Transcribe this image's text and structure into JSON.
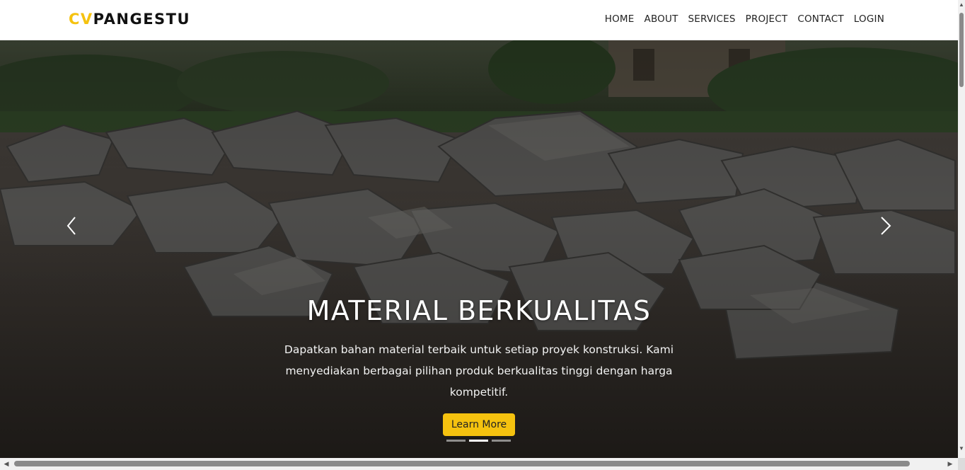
{
  "header": {
    "brand_accent": "CV",
    "brand_rest": "PANGESTU",
    "nav": [
      "HOME",
      "ABOUT",
      "SERVICES",
      "PROJECT",
      "CONTACT",
      "LOGIN"
    ]
  },
  "hero": {
    "title": "MATERIAL BERKUALITAS",
    "description": "Dapatkan bahan material terbaik untuk setiap proyek konstruksi. Kami menyediakan berbagai pilihan produk berkualitas tinggi dengan harga kompetitif.",
    "button_label": "Learn More",
    "prev_icon": "chevron-left-icon",
    "next_icon": "chevron-right-icon",
    "slide_count": 3,
    "active_slide": 2
  },
  "colors": {
    "accent": "#f5c20f",
    "header_bg": "#ffffff",
    "nav_text": "#222222"
  }
}
